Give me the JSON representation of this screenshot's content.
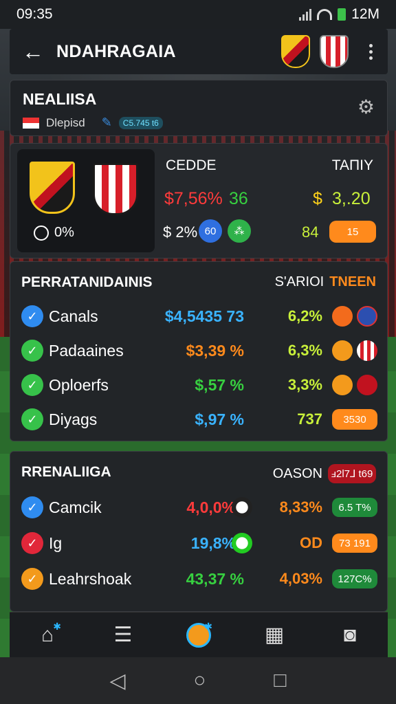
{
  "status_bar": {
    "time": "09:35",
    "network": "12M"
  },
  "app_bar": {
    "title": "NDAHRAGAIA"
  },
  "league": {
    "name": "NEALIISA",
    "country": "Dlepisd",
    "tag": "C5.745 t6"
  },
  "match": {
    "timer": "0%",
    "col1_header": "CEDDE",
    "col1_odds": "$7,56%",
    "col1_odds_extra": "36",
    "col1_price": "$ 2%",
    "col1_badge": "60",
    "col2_header": "TAΠIY",
    "col2_price": "$",
    "col2_value": "3,.20",
    "col2_count": "84",
    "col2_pill": "15"
  },
  "table1": {
    "title": "PERRATANIDAINIS",
    "right_label": "S'ARIOI",
    "right_label_alt": "TNEEN",
    "rows": [
      {
        "label": "Canals",
        "value": "$4,5435 73",
        "pct": "6,2%",
        "end_text": ""
      },
      {
        "label": "Padaaines",
        "value": "$3,39 %",
        "pct": "6,3%",
        "end_text": ""
      },
      {
        "label": "Oploerfs",
        "value": "$,57 %",
        "pct": "3,3%",
        "end_text": ""
      },
      {
        "label": "Diyags",
        "value": "$,97 %",
        "pct": "737",
        "end_text": "3530"
      }
    ]
  },
  "table2": {
    "title": "RRENALIIGA",
    "right_label": "OASON",
    "right_pill": "ⅎ2l7⅃ t69",
    "rows": [
      {
        "label": "Camcik",
        "value": "4,0,0%",
        "pct": "8,33%",
        "end_text": "6.5 T%"
      },
      {
        "label": "Ig",
        "value": "19,8%",
        "pct": "OD",
        "end_text": "73 191"
      },
      {
        "label": "Leahrshoak",
        "value": "43,37 %",
        "pct": "4,03%",
        "end_text": "127C%"
      }
    ]
  },
  "colors": {
    "accent_blue": "#2f8cf0",
    "accent_orange": "#ff8a1c",
    "accent_green": "#37d040",
    "accent_red": "#ff3b3b"
  }
}
